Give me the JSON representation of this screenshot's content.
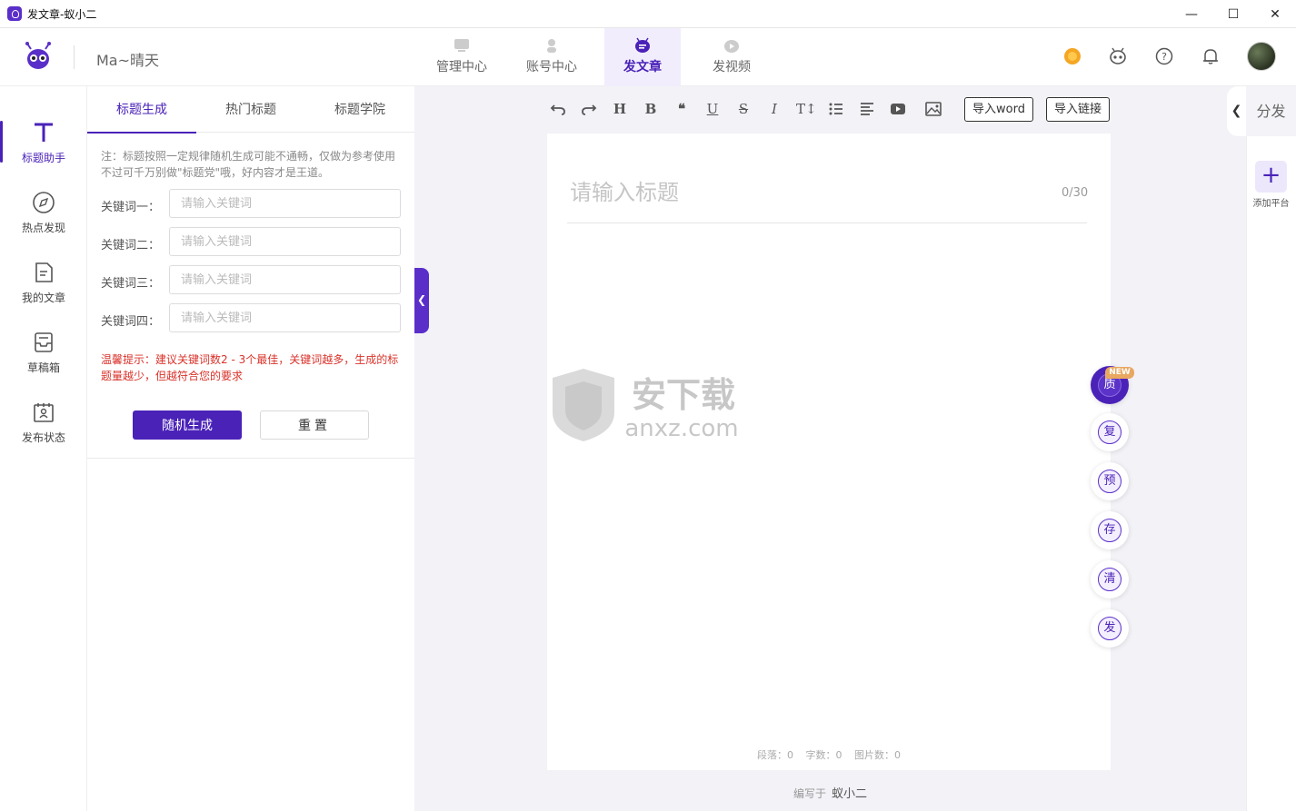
{
  "window": {
    "title": "发文章-蚁小二",
    "controls": {
      "minimize": "—",
      "maximize": "☐",
      "close": "✕"
    }
  },
  "header": {
    "username": "Ma~晴天",
    "nav": [
      {
        "label": "管理中心",
        "icon": "monitor-icon",
        "active": false
      },
      {
        "label": "账号中心",
        "icon": "user-icon",
        "active": false
      },
      {
        "label": "发文章",
        "icon": "article-icon",
        "active": true
      },
      {
        "label": "发视频",
        "icon": "video-icon",
        "active": false
      }
    ],
    "icons": [
      "coin-icon",
      "robot-icon",
      "help-icon",
      "bell-icon",
      "avatar"
    ]
  },
  "rail": [
    {
      "label": "标题助手",
      "icon": "title-t-icon",
      "active": true
    },
    {
      "label": "热点发现",
      "icon": "compass-icon",
      "active": false
    },
    {
      "label": "我的文章",
      "icon": "document-icon",
      "active": false
    },
    {
      "label": "草稿箱",
      "icon": "inbox-icon",
      "active": false
    },
    {
      "label": "发布状态",
      "icon": "calendar-user-icon",
      "active": false
    }
  ],
  "panel": {
    "tabs": [
      "标题生成",
      "热门标题",
      "标题学院"
    ],
    "note": "注：标题按照一定规律随机生成可能不通畅，仅做为参考使用不过可千万别做\"标题党\"哦，好内容才是王道。",
    "keywords": [
      {
        "label": "关键词一：",
        "placeholder": "请输入关键词",
        "value": ""
      },
      {
        "label": "关键词二：",
        "placeholder": "请输入关键词",
        "value": ""
      },
      {
        "label": "关键词三：",
        "placeholder": "请输入关键词",
        "value": ""
      },
      {
        "label": "关键词四：",
        "placeholder": "请输入关键词",
        "value": ""
      }
    ],
    "tip": "温馨提示：建议关键词数2 - 3个最佳，关键词越多，生成的标题量越少，但越符合您的要求",
    "generate_label": "随机生成",
    "reset_label": "重置"
  },
  "toolbar": {
    "icons": [
      "undo-icon",
      "redo-icon",
      "heading-icon",
      "bold-icon",
      "quote-icon",
      "underline-icon",
      "strikethrough-icon",
      "italic-icon",
      "font-size-icon",
      "list-icon",
      "align-icon",
      "video-embed-icon",
      "image-icon"
    ],
    "import_word": "导入word",
    "import_link": "导入链接"
  },
  "editor": {
    "title_placeholder": "请输入标题",
    "title_value": "",
    "counter": "0/30",
    "stats": {
      "paragraphs": "段落：0",
      "words": "字数：0",
      "images": "图片数：0"
    },
    "author_prefix": "编写于",
    "author_name": "蚁小二"
  },
  "watermark": {
    "text": "安下载",
    "domain": "anxz.com"
  },
  "side_buttons": [
    {
      "label": "质",
      "badge": "NEW",
      "filled": true
    },
    {
      "label": "复",
      "filled": false
    },
    {
      "label": "预",
      "filled": false
    },
    {
      "label": "存",
      "filled": false
    },
    {
      "label": "清",
      "filled": false
    },
    {
      "label": "发",
      "filled": false
    }
  ],
  "right_panel": {
    "title": "分发",
    "add_label": "添加平台",
    "add_symbol": "+"
  },
  "colors": {
    "accent": "#4a22b8",
    "warning_text": "#d9322a",
    "editor_bg": "#f2f2f7"
  }
}
